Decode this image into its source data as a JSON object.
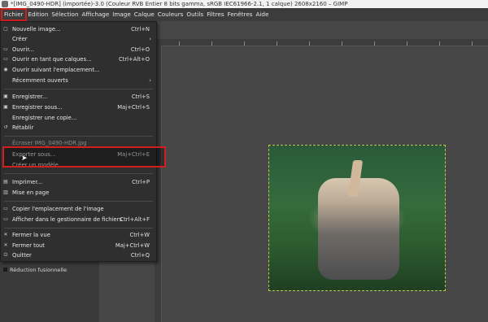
{
  "window": {
    "title": "*[IMG_0490-HDR] (importée)-3.0 (Couleur RVB Entier 8 bits gamma, sRGB IEC61966-2.1, 1 calque) 2608x2160 – GIMP"
  },
  "menubar": {
    "items": [
      "Fichier",
      "Edition",
      "Sélection",
      "Affichage",
      "Image",
      "Calque",
      "Couleurs",
      "Outils",
      "Filtres",
      "Fenêtres",
      "Aide"
    ]
  },
  "file_menu": {
    "items": [
      {
        "icon": "new-image-icon",
        "label": "Nouvelle image...",
        "shortcut": "Ctrl+N"
      },
      {
        "icon": "",
        "label": "Créer",
        "submenu": true
      },
      {
        "icon": "open-icon",
        "label": "Ouvrir...",
        "shortcut": "Ctrl+O"
      },
      {
        "icon": "open-as-layers-icon",
        "label": "Ouvrir en tant que calques...",
        "shortcut": "Ctrl+Alt+O"
      },
      {
        "icon": "open-location-icon",
        "label": "Ouvrir suivant l'emplacement..."
      },
      {
        "icon": "",
        "label": "Récemment ouverts",
        "submenu": true
      },
      {
        "icon": "save-icon",
        "label": "Enregistrer...",
        "shortcut": "Ctrl+S"
      },
      {
        "icon": "save-as-icon",
        "label": "Enregistrer sous...",
        "shortcut": "Maj+Ctrl+S"
      },
      {
        "icon": "",
        "label": "Enregistrer une copie..."
      },
      {
        "icon": "revert-icon",
        "label": "Rétablir"
      },
      {
        "icon": "",
        "label": "Écraser IMG_0490-HDR.jpg"
      },
      {
        "icon": "",
        "label": "Exporter sous...",
        "shortcut": "Maj+Ctrl+E"
      },
      {
        "icon": "",
        "label": "Créer un modèle..."
      },
      {
        "icon": "print-icon",
        "label": "Imprimer...",
        "shortcut": "Ctrl+P"
      },
      {
        "icon": "page-setup-icon",
        "label": "Mise en page"
      },
      {
        "icon": "copy-location-icon",
        "label": "Copier l'emplacement de l'image"
      },
      {
        "icon": "file-manager-icon",
        "label": "Afficher dans le gestionnaire de fichiers",
        "shortcut": "Ctrl+Alt+F"
      },
      {
        "icon": "close-view-icon",
        "label": "Fermer la vue",
        "shortcut": "Ctrl+W"
      },
      {
        "icon": "close-all-icon",
        "label": "Fermer tout",
        "shortcut": "Maj+Ctrl+W"
      },
      {
        "icon": "quit-icon",
        "label": "Quitter",
        "shortcut": "Ctrl+Q"
      }
    ]
  },
  "layers": {
    "mode_label": "Réduction fusionnelle"
  },
  "colors": {
    "highlight": "#d0201e"
  }
}
